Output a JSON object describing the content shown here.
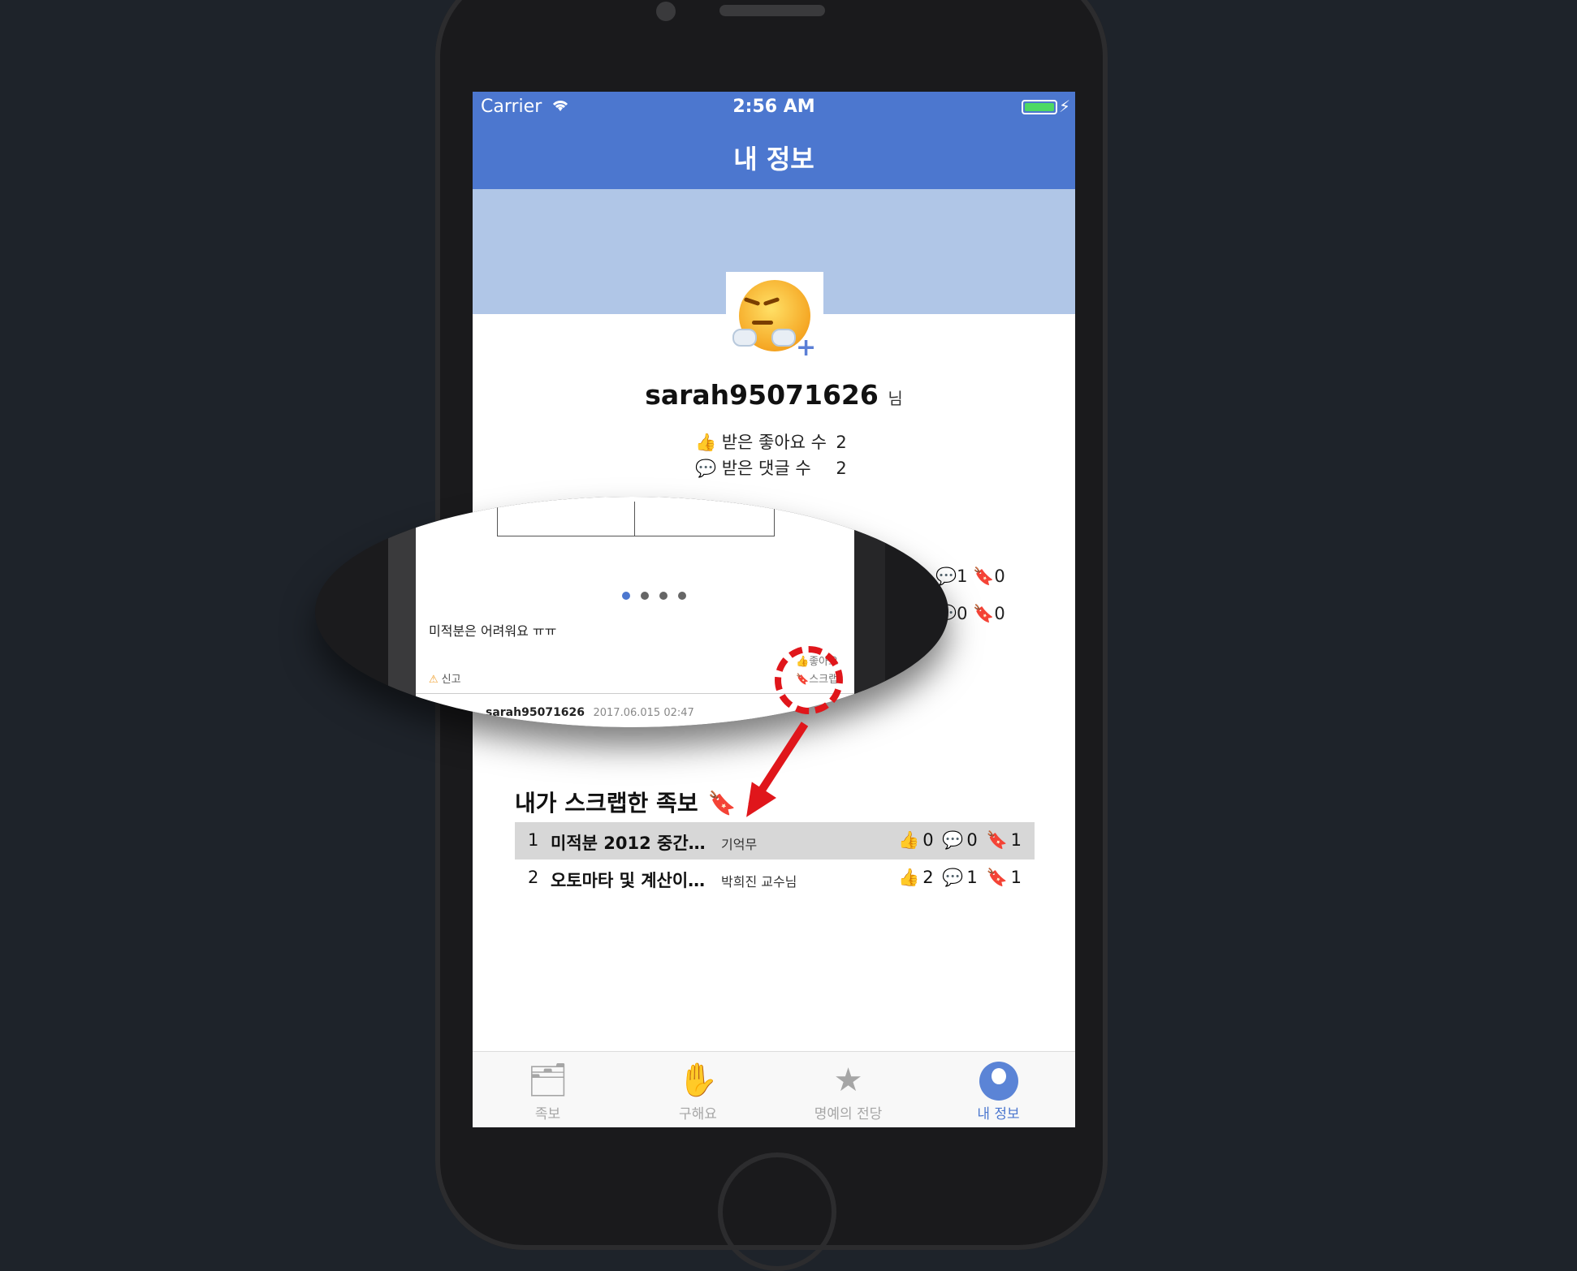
{
  "status_bar": {
    "carrier": "Carrier",
    "time": "2:56 AM"
  },
  "nav": {
    "title": "내 정보"
  },
  "profile": {
    "username": "sarah95071626",
    "honorific": "님",
    "likes_label": "받은 좋아요 수",
    "likes_count": "2",
    "comments_label": "받은 댓글 수",
    "comments_count": "2"
  },
  "magnified": {
    "post_text": "미적분은 어려워요 ㅠㅠ",
    "report_label": "신고",
    "like_label": "좋아요",
    "scrap_label": "스크랩",
    "author": "sarah95071626",
    "date": "2017.06.015 02:47",
    "page_dots": 4,
    "active_dot": 0
  },
  "partial_rows": [
    {
      "comments": "1",
      "scraps": "0"
    },
    {
      "comments": "0",
      "scraps": "0"
    }
  ],
  "scrap_section": {
    "title": "내가 스크랩한 족보",
    "items": [
      {
        "num": "1",
        "title": "미적분 2012 중간…",
        "author": "기억무",
        "likes": "0",
        "comments": "0",
        "scraps": "1",
        "selected": true
      },
      {
        "num": "2",
        "title": "오토마타 및 계산이…",
        "author": "박희진 교수님",
        "likes": "2",
        "comments": "1",
        "scraps": "1",
        "selected": false
      }
    ]
  },
  "tabs": [
    {
      "label": "족보",
      "icon": "document-icon",
      "active": false
    },
    {
      "label": "구해요",
      "icon": "hand-icon",
      "active": false
    },
    {
      "label": "명예의 전당",
      "icon": "star-icon",
      "active": false
    },
    {
      "label": "내 정보",
      "icon": "user-icon",
      "active": true
    }
  ],
  "colors": {
    "nav": "#4c77cf",
    "banner": "#b0c6e7",
    "like": "#4c77cf",
    "comment": "#e23b3b",
    "scrap": "#f3c34a",
    "annotation": "#e0161b"
  }
}
